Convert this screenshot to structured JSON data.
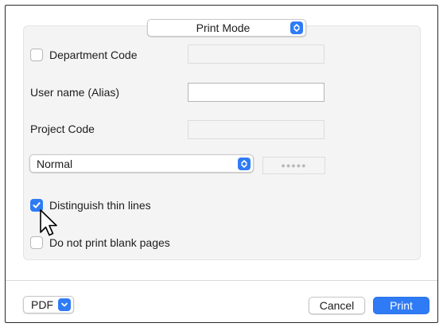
{
  "dialog": {
    "mode_popup": {
      "value": "Print Mode",
      "icon": "chevron-updown-icon"
    },
    "department_code": {
      "label": "Department Code",
      "checked": false,
      "value": ""
    },
    "user_name": {
      "label": "User name (Alias)",
      "value": ""
    },
    "project_code": {
      "label": "Project Code",
      "value": ""
    },
    "mode_select": {
      "value": "Normal",
      "icon": "chevron-updown-icon"
    },
    "password_dots": "●●●●●",
    "distinguish_thin_lines": {
      "label": "Distinguish thin lines",
      "checked": true
    },
    "do_not_print_blank": {
      "label": "Do not print blank pages",
      "checked": false
    }
  },
  "footer": {
    "pdf_label": "PDF",
    "cancel_label": "Cancel",
    "print_label": "Print"
  },
  "colors": {
    "accent": "#2f7bf5",
    "panel_bg": "#f4f4f4",
    "border": "#c9c9c9"
  }
}
